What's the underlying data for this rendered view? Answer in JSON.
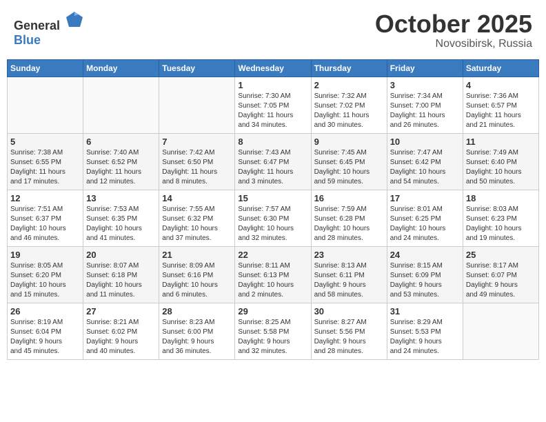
{
  "header": {
    "logo_general": "General",
    "logo_blue": "Blue",
    "month": "October 2025",
    "location": "Novosibirsk, Russia"
  },
  "weekdays": [
    "Sunday",
    "Monday",
    "Tuesday",
    "Wednesday",
    "Thursday",
    "Friday",
    "Saturday"
  ],
  "weeks": [
    [
      {
        "day": "",
        "info": ""
      },
      {
        "day": "",
        "info": ""
      },
      {
        "day": "",
        "info": ""
      },
      {
        "day": "1",
        "info": "Sunrise: 7:30 AM\nSunset: 7:05 PM\nDaylight: 11 hours\nand 34 minutes."
      },
      {
        "day": "2",
        "info": "Sunrise: 7:32 AM\nSunset: 7:02 PM\nDaylight: 11 hours\nand 30 minutes."
      },
      {
        "day": "3",
        "info": "Sunrise: 7:34 AM\nSunset: 7:00 PM\nDaylight: 11 hours\nand 26 minutes."
      },
      {
        "day": "4",
        "info": "Sunrise: 7:36 AM\nSunset: 6:57 PM\nDaylight: 11 hours\nand 21 minutes."
      }
    ],
    [
      {
        "day": "5",
        "info": "Sunrise: 7:38 AM\nSunset: 6:55 PM\nDaylight: 11 hours\nand 17 minutes."
      },
      {
        "day": "6",
        "info": "Sunrise: 7:40 AM\nSunset: 6:52 PM\nDaylight: 11 hours\nand 12 minutes."
      },
      {
        "day": "7",
        "info": "Sunrise: 7:42 AM\nSunset: 6:50 PM\nDaylight: 11 hours\nand 8 minutes."
      },
      {
        "day": "8",
        "info": "Sunrise: 7:43 AM\nSunset: 6:47 PM\nDaylight: 11 hours\nand 3 minutes."
      },
      {
        "day": "9",
        "info": "Sunrise: 7:45 AM\nSunset: 6:45 PM\nDaylight: 10 hours\nand 59 minutes."
      },
      {
        "day": "10",
        "info": "Sunrise: 7:47 AM\nSunset: 6:42 PM\nDaylight: 10 hours\nand 54 minutes."
      },
      {
        "day": "11",
        "info": "Sunrise: 7:49 AM\nSunset: 6:40 PM\nDaylight: 10 hours\nand 50 minutes."
      }
    ],
    [
      {
        "day": "12",
        "info": "Sunrise: 7:51 AM\nSunset: 6:37 PM\nDaylight: 10 hours\nand 46 minutes."
      },
      {
        "day": "13",
        "info": "Sunrise: 7:53 AM\nSunset: 6:35 PM\nDaylight: 10 hours\nand 41 minutes."
      },
      {
        "day": "14",
        "info": "Sunrise: 7:55 AM\nSunset: 6:32 PM\nDaylight: 10 hours\nand 37 minutes."
      },
      {
        "day": "15",
        "info": "Sunrise: 7:57 AM\nSunset: 6:30 PM\nDaylight: 10 hours\nand 32 minutes."
      },
      {
        "day": "16",
        "info": "Sunrise: 7:59 AM\nSunset: 6:28 PM\nDaylight: 10 hours\nand 28 minutes."
      },
      {
        "day": "17",
        "info": "Sunrise: 8:01 AM\nSunset: 6:25 PM\nDaylight: 10 hours\nand 24 minutes."
      },
      {
        "day": "18",
        "info": "Sunrise: 8:03 AM\nSunset: 6:23 PM\nDaylight: 10 hours\nand 19 minutes."
      }
    ],
    [
      {
        "day": "19",
        "info": "Sunrise: 8:05 AM\nSunset: 6:20 PM\nDaylight: 10 hours\nand 15 minutes."
      },
      {
        "day": "20",
        "info": "Sunrise: 8:07 AM\nSunset: 6:18 PM\nDaylight: 10 hours\nand 11 minutes."
      },
      {
        "day": "21",
        "info": "Sunrise: 8:09 AM\nSunset: 6:16 PM\nDaylight: 10 hours\nand 6 minutes."
      },
      {
        "day": "22",
        "info": "Sunrise: 8:11 AM\nSunset: 6:13 PM\nDaylight: 10 hours\nand 2 minutes."
      },
      {
        "day": "23",
        "info": "Sunrise: 8:13 AM\nSunset: 6:11 PM\nDaylight: 9 hours\nand 58 minutes."
      },
      {
        "day": "24",
        "info": "Sunrise: 8:15 AM\nSunset: 6:09 PM\nDaylight: 9 hours\nand 53 minutes."
      },
      {
        "day": "25",
        "info": "Sunrise: 8:17 AM\nSunset: 6:07 PM\nDaylight: 9 hours\nand 49 minutes."
      }
    ],
    [
      {
        "day": "26",
        "info": "Sunrise: 8:19 AM\nSunset: 6:04 PM\nDaylight: 9 hours\nand 45 minutes."
      },
      {
        "day": "27",
        "info": "Sunrise: 8:21 AM\nSunset: 6:02 PM\nDaylight: 9 hours\nand 40 minutes."
      },
      {
        "day": "28",
        "info": "Sunrise: 8:23 AM\nSunset: 6:00 PM\nDaylight: 9 hours\nand 36 minutes."
      },
      {
        "day": "29",
        "info": "Sunrise: 8:25 AM\nSunset: 5:58 PM\nDaylight: 9 hours\nand 32 minutes."
      },
      {
        "day": "30",
        "info": "Sunrise: 8:27 AM\nSunset: 5:56 PM\nDaylight: 9 hours\nand 28 minutes."
      },
      {
        "day": "31",
        "info": "Sunrise: 8:29 AM\nSunset: 5:53 PM\nDaylight: 9 hours\nand 24 minutes."
      },
      {
        "day": "",
        "info": ""
      }
    ]
  ]
}
